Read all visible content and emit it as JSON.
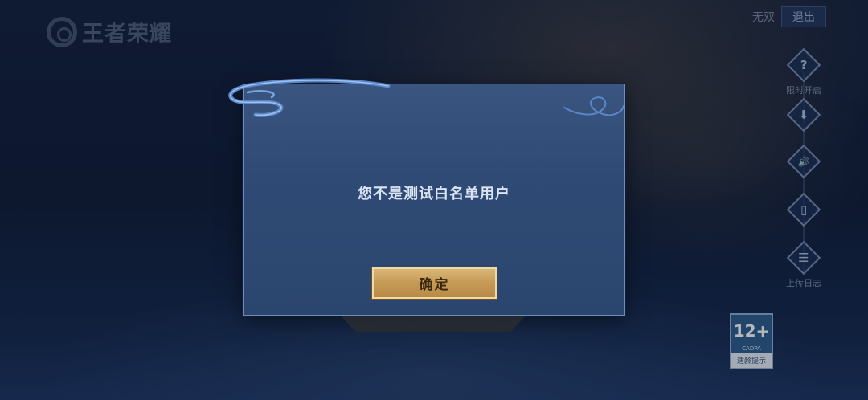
{
  "app": {
    "logo_text": "王者荣耀"
  },
  "top_right": {
    "label": "无双",
    "exit_label": "退出"
  },
  "side_menu": [
    {
      "icon": "question-icon",
      "glyph": "?",
      "label": "限时开启"
    },
    {
      "icon": "download-icon",
      "glyph": "⬇",
      "label": ""
    },
    {
      "icon": "sound-icon",
      "glyph": "🔊",
      "label": ""
    },
    {
      "icon": "phone-icon",
      "glyph": "▯",
      "label": ""
    },
    {
      "icon": "log-icon",
      "glyph": "☰",
      "label": "上传日志"
    }
  ],
  "age_rating": {
    "number": "12+",
    "org": "CADPA",
    "tip": "适龄提示"
  },
  "dialog": {
    "message": "您不是测试白名单用户",
    "confirm_label": "确定"
  },
  "colors": {
    "accent_gold": "#c79c58",
    "dialog_bg": "#2f4b75",
    "dialog_border": "#6d8fbd"
  }
}
